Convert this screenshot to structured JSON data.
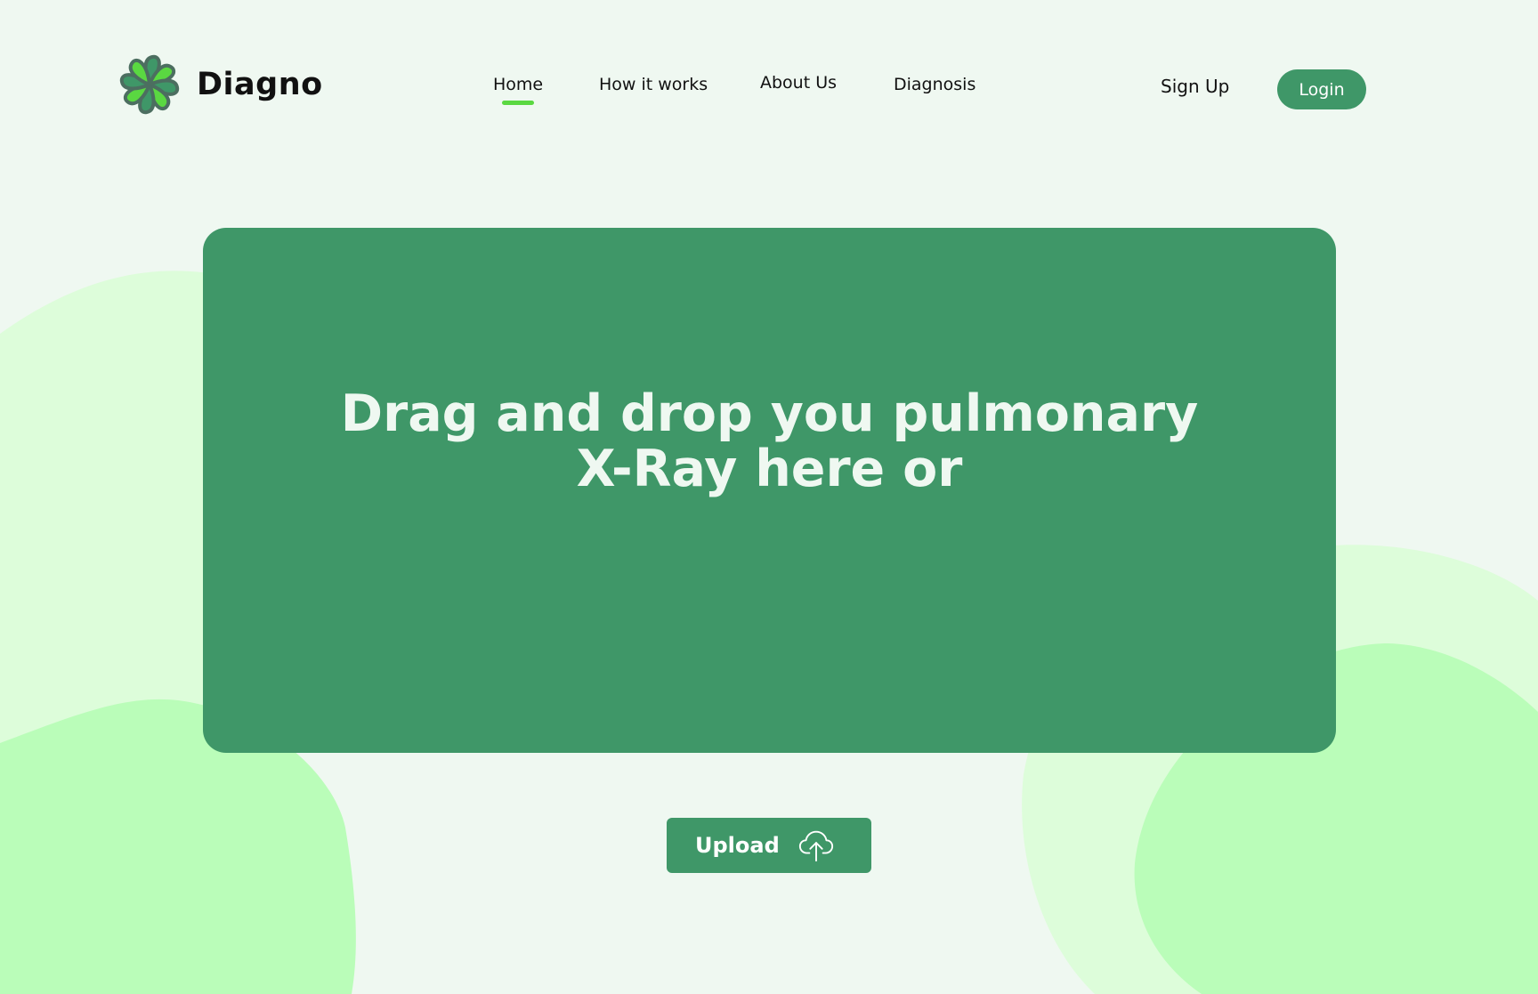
{
  "brand": {
    "name": "Diagno"
  },
  "nav": {
    "items": [
      {
        "label": "Home",
        "active": true
      },
      {
        "label": "How it works",
        "active": false
      },
      {
        "label": "About Us",
        "active": false
      },
      {
        "label": "Diagnosis",
        "active": false
      }
    ]
  },
  "auth": {
    "signup_label": "Sign Up",
    "login_label": "Login"
  },
  "dropzone": {
    "line1": "Drag and drop you pulmonary",
    "line2": "X-Ray here or"
  },
  "upload": {
    "label": "Upload",
    "icon": "cloud-upload-icon"
  },
  "colors": {
    "background": "#eff8f1",
    "primary": "#3f9768",
    "accent": "#5ad841",
    "blob_light": "#ddfdda",
    "blob_mid": "#bafdb9"
  }
}
